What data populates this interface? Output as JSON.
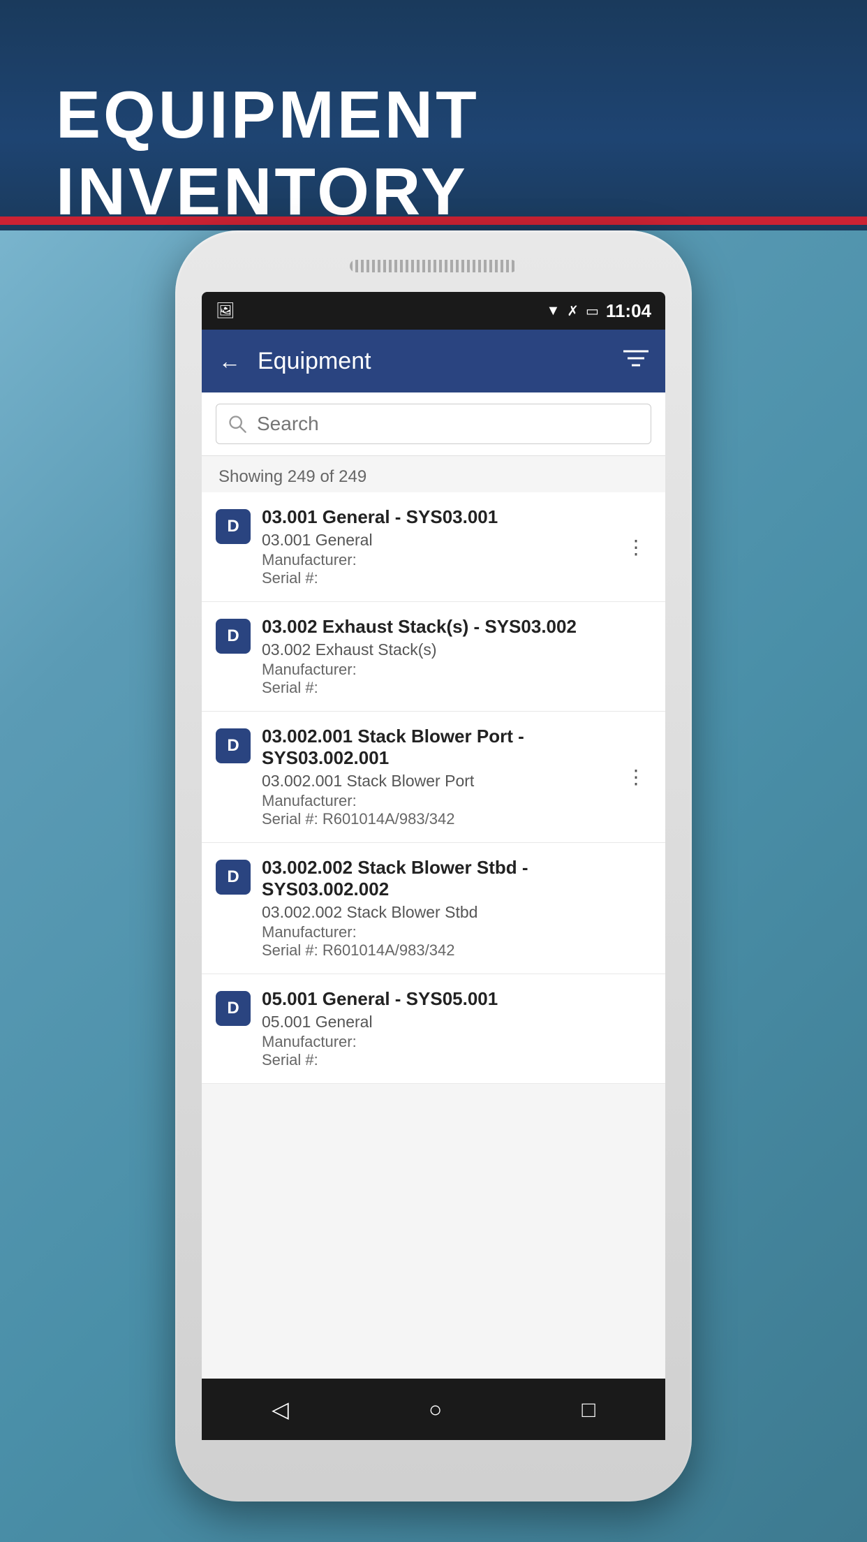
{
  "app": {
    "title": "EQUIPMENT INVENTORY"
  },
  "status_bar": {
    "time": "11:04",
    "icons": [
      "wifi",
      "signal-off",
      "battery"
    ]
  },
  "app_bar": {
    "back_label": "←",
    "title": "Equipment",
    "filter_label": "⊟"
  },
  "search": {
    "placeholder": "Search"
  },
  "count": {
    "text": "Showing 249 of 249"
  },
  "equipment_items": [
    {
      "badge": "D",
      "title": "03.001 General - SYS03.001",
      "subtitle": "03.001 General",
      "manufacturer": "Manufacturer:",
      "serial": "Serial #:",
      "has_more": true
    },
    {
      "badge": "D",
      "title": "03.002 Exhaust Stack(s) - SYS03.002",
      "subtitle": "03.002 Exhaust Stack(s)",
      "manufacturer": "Manufacturer:",
      "serial": "Serial #:",
      "has_more": false
    },
    {
      "badge": "D",
      "title": "03.002.001 Stack Blower Port - SYS03.002.001",
      "subtitle": "03.002.001 Stack Blower Port",
      "manufacturer": "Manufacturer:",
      "serial": "Serial #: R601014A/983/342",
      "has_more": true
    },
    {
      "badge": "D",
      "title": "03.002.002 Stack Blower Stbd - SYS03.002.002",
      "subtitle": "03.002.002 Stack Blower Stbd",
      "manufacturer": "Manufacturer:",
      "serial": "Serial #: R601014A/983/342",
      "has_more": false
    },
    {
      "badge": "D",
      "title": "05.001 General - SYS05.001",
      "subtitle": "05.001 General",
      "manufacturer": "Manufacturer:",
      "serial": "Serial #:",
      "has_more": false
    }
  ],
  "nav_bar": {
    "back_btn": "◁",
    "home_btn": "○",
    "recent_btn": "□"
  },
  "colors": {
    "header_bg": "#1a3a5c",
    "header_red": "#cc2233",
    "app_bar_bg": "#2a4480",
    "badge_bg": "#2a4480"
  }
}
